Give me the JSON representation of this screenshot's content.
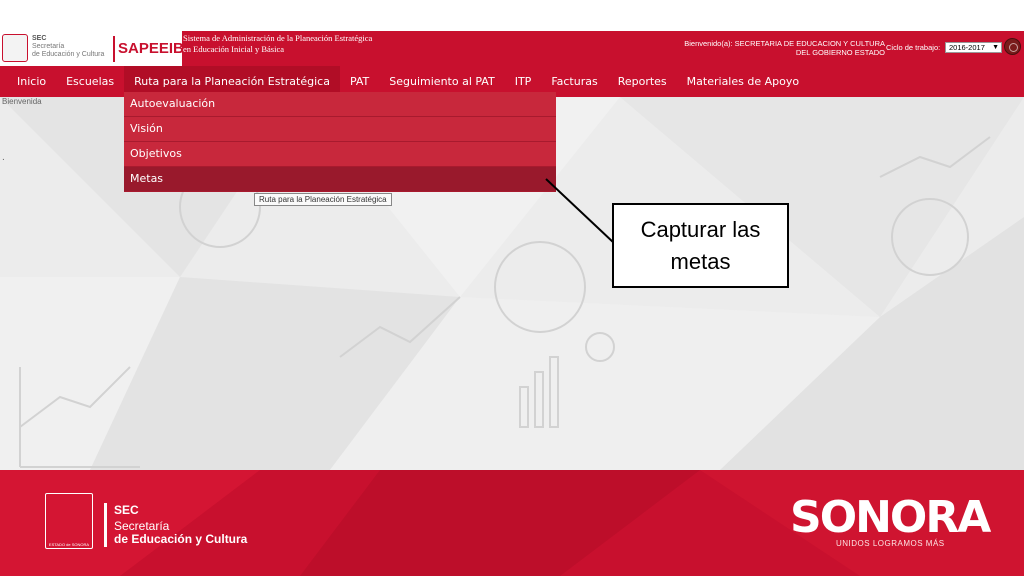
{
  "header": {
    "sec_logo_line1": "SEC",
    "sec_logo_line2": "Secretaría",
    "sec_logo_line3": "de Educación y Cultura",
    "app_name": "SAPEEIB",
    "system_title": "Sistema de Administración de la Planeación Estratégica en Educación Inicial y Básica",
    "welcome_text": "Bienvenido(a): SECRETARIA DE EDUCACION Y CULTURA DEL GOBIERNO ESTADO",
    "ciclo_label": "Ciclo de trabajo:",
    "ciclo_value": "2016-2017"
  },
  "nav": {
    "items": [
      "Inicio",
      "Escuelas",
      "Ruta para la Planeación Estratégica",
      "PAT",
      "Seguimiento al PAT",
      "ITP",
      "Facturas",
      "Reportes",
      "Materiales de Apoyo"
    ],
    "active": "Ruta para la Planeación Estratégica"
  },
  "dropdown": {
    "items": [
      "Autoevaluación",
      "Visión",
      "Objetivos",
      "Metas"
    ],
    "hovered": "Metas",
    "tooltip": "Ruta para la Planeación Estratégica"
  },
  "content": {
    "bienvenida": "Bienvenida",
    "dot": "."
  },
  "callout": {
    "text": "Capturar las metas"
  },
  "footer": {
    "sec": "SEC",
    "secretaria": "Secretaría",
    "educacion": "de Educación y Cultura",
    "emblem_label": "ESTADO de SONORA",
    "sonora": "SONORA",
    "tagline": "UNIDOS LOGRAMOS MÁS"
  },
  "colors": {
    "brand_red": "#c8102e",
    "menu_red": "#c8283c",
    "menu_hover": "#99192c"
  },
  "icons": [
    "power-icon",
    "select-arrow-icon",
    "sec-emblem-icon",
    "state-emblem-icon"
  ]
}
